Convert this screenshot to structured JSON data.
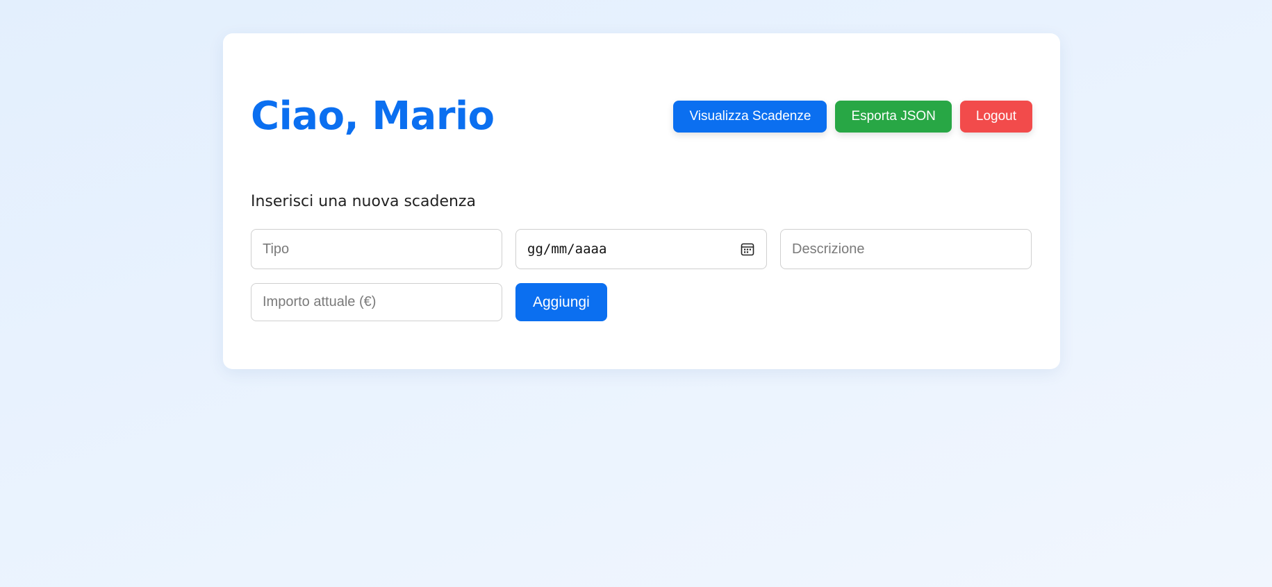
{
  "header": {
    "greeting": "Ciao, Mario",
    "buttons": {
      "view_deadlines": "Visualizza Scadenze",
      "export_json": "Esporta JSON",
      "logout": "Logout"
    }
  },
  "form": {
    "title": "Inserisci una nuova scadenza",
    "tipo_placeholder": "Tipo",
    "date_placeholder": "gg/mm/aaaa",
    "descrizione_placeholder": "Descrizione",
    "importo_placeholder": "Importo attuale (€)",
    "add_label": "Aggiungi"
  },
  "colors": {
    "accent": "#0b6ff0",
    "success": "#28a745",
    "danger": "#f24b4b"
  },
  "icons": {
    "date_picker": "calendar-icon"
  }
}
